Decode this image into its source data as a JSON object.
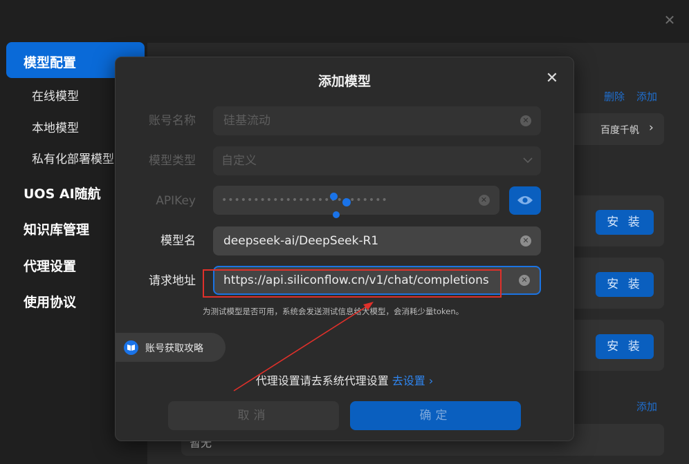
{
  "sidebar": {
    "items": [
      {
        "label": "模型配置"
      },
      {
        "label": "在线模型"
      },
      {
        "label": "本地模型"
      },
      {
        "label": "私有化部署模型"
      },
      {
        "label": "UOS AI随航"
      },
      {
        "label": "知识库管理"
      },
      {
        "label": "代理设置"
      },
      {
        "label": "使用协议"
      }
    ]
  },
  "main": {
    "delete_label": "删除",
    "add_label": "添加",
    "model_item": "百度千帆",
    "install_label": "安 装",
    "add_label_2": "添加",
    "bottom_text": "暂无"
  },
  "dialog": {
    "title": "添加模型",
    "fields": {
      "account_name": {
        "label": "账号名称",
        "value": "硅基流动"
      },
      "model_type": {
        "label": "模型类型",
        "value": "自定义"
      },
      "api_key": {
        "label": "APIKey",
        "value": "••••••••••••••••••••••••••"
      },
      "model_name": {
        "label": "模型名",
        "value": "deepseek-ai/DeepSeek-R1"
      },
      "request_url": {
        "label": "请求地址",
        "value": "https://api.siliconflow.cn/v1/chat/completions"
      }
    },
    "hint": "为测试模型是否可用，系统会发送测试信息给大模型，会消耗少量token。",
    "guide_label": "账号获取攻略",
    "proxy_text": "代理设置请去系统代理设置",
    "proxy_link": "去设置",
    "cancel_label": "取消",
    "confirm_label": "确定"
  },
  "colors": {
    "accent": "#0a6ad8",
    "annotation_red": "#e0302a"
  }
}
